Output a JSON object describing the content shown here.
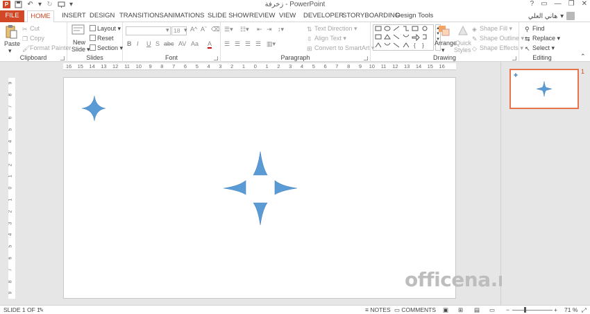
{
  "window": {
    "title": "زخرفة - PowerPoint",
    "controls": [
      "?",
      "▭",
      "—",
      "❐",
      "✕"
    ]
  },
  "tabs": {
    "file": "FILE",
    "items": [
      "HOME",
      "INSERT",
      "DESIGN",
      "TRANSITIONS",
      "ANIMATIONS",
      "SLIDE SHOW",
      "REVIEW",
      "VIEW",
      "DEVELOPER",
      "STORYBOARDING",
      "Design Tools"
    ],
    "active": "HOME"
  },
  "user": {
    "name": "هاني العلي"
  },
  "ribbon": {
    "clipboard": {
      "label": "Clipboard",
      "paste": "Paste",
      "cut": "Cut",
      "copy": "Copy",
      "format_painter": "Format Painter"
    },
    "slides": {
      "label": "Slides",
      "new_slide_line1": "New",
      "new_slide_line2": "Slide",
      "layout": "Layout",
      "reset": "Reset",
      "section": "Section"
    },
    "font": {
      "label": "Font",
      "size": "18",
      "bold": "B",
      "italic": "I",
      "underline": "U",
      "strike": "S",
      "shadow": "abc",
      "spacing": "AV",
      "case": "Aa",
      "clear": "A",
      "color": "A"
    },
    "paragraph": {
      "label": "Paragraph",
      "text_direction": "Text Direction",
      "align_text": "Align Text",
      "convert_smartart": "Convert to SmartArt"
    },
    "drawing": {
      "label": "Drawing",
      "arrange": "Arrange",
      "quick_styles_1": "Quick",
      "quick_styles_2": "Styles",
      "shape_fill": "Shape Fill",
      "shape_outline": "Shape Outline",
      "shape_effects": "Shape Effects"
    },
    "editing": {
      "label": "Editing",
      "find": "Find",
      "replace": "Replace",
      "select": "Select"
    }
  },
  "ruler": {
    "h_labels": [
      "16",
      "15",
      "14",
      "13",
      "12",
      "11",
      "10",
      "9",
      "8",
      "7",
      "6",
      "5",
      "4",
      "3",
      "2",
      "1",
      "0",
      "1",
      "2",
      "3",
      "4",
      "5",
      "6",
      "7",
      "8",
      "9",
      "10",
      "11",
      "12",
      "13",
      "14",
      "15",
      "16"
    ],
    "v_labels": [
      "9",
      "8",
      "7",
      "6",
      "5",
      "4",
      "3",
      "2",
      "1",
      "0",
      "1",
      "2",
      "3",
      "4",
      "5",
      "6",
      "7",
      "8",
      "9"
    ]
  },
  "slide": {
    "shape_color": "#5b9bd5",
    "watermark": "officena.net"
  },
  "thumbnails": {
    "slide_number": "1"
  },
  "status": {
    "slide_info": "SLIDE 1 OF 1",
    "notes": "NOTES",
    "comments": "COMMENTS",
    "zoom": "71 %"
  }
}
